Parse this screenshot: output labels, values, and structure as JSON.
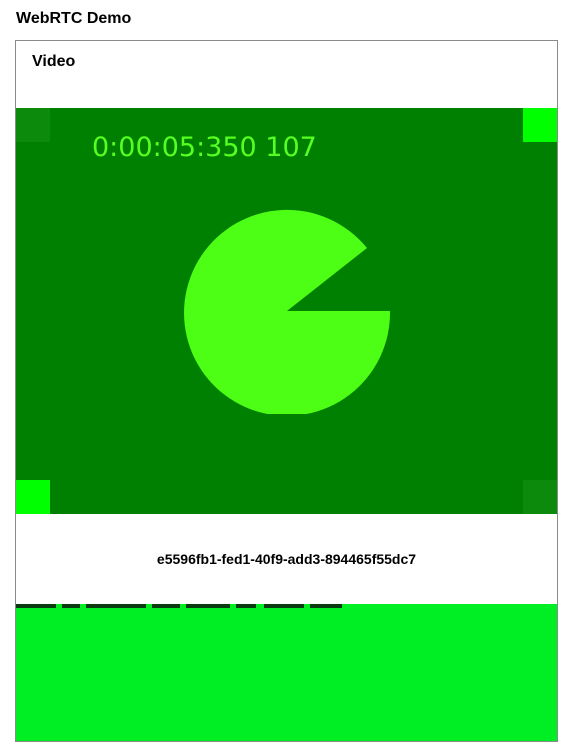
{
  "page": {
    "title": "WebRTC Demo"
  },
  "panel": {
    "title": "Video"
  },
  "video": {
    "timecode": "0:00:05:350 107",
    "stream_id": "e5596fb1-fed1-40f9-add3-894465f55dc7"
  },
  "colors": {
    "video_background": "#008000",
    "timecode": "#55ff22",
    "pie": "#4cff14",
    "corner_bright": "#00ff00",
    "corner_dim": "#0b8a0b",
    "lower_video": "#00ef24"
  }
}
